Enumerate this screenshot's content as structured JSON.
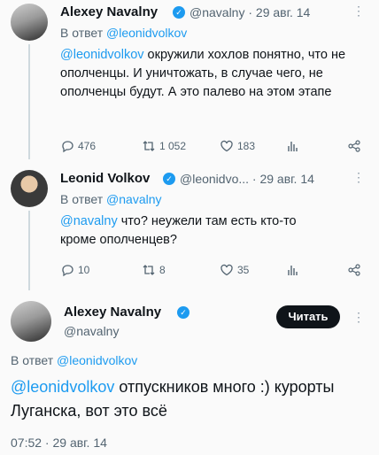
{
  "tweet1": {
    "display_name": "Alexey Navalny",
    "handle_date": "@navalny · 29 авг. 14",
    "reply_prefix": "В ответ ",
    "reply_to": "@leonidvolkov",
    "mention": "@leonidvolkov",
    "text": " окружили хохлов понятно, что не ополченцы. И уничтожать, в случае чего, не ополченцы будут. А это палево на этом этапе",
    "replies": "476",
    "retweets": "1 052",
    "likes": "183"
  },
  "tweet2": {
    "display_name": "Leonid Volkov",
    "handle_date": "@leonidvo... · 29 авг. 14",
    "reply_prefix": "В ответ ",
    "reply_to": "@navalny",
    "mention": "@navalny",
    "text": " что? неужели там есть кто-то кроме ополченцев?",
    "replies": "10",
    "retweets": "8",
    "likes": "35"
  },
  "main_tweet": {
    "display_name": "Alexey Navalny",
    "handle": "@navalny",
    "follow_label": "Читать",
    "reply_prefix": "В ответ ",
    "reply_to": "@leonidvolkov",
    "mention": "@leonidvolkov",
    "text": " отпускников много :) курорты Луганска, вот это всё",
    "timestamp": "07:52 · 29 авг. 14"
  },
  "colors": {
    "accent": "#1d9bf0",
    "text": "#0f1419",
    "muted": "#536471"
  }
}
